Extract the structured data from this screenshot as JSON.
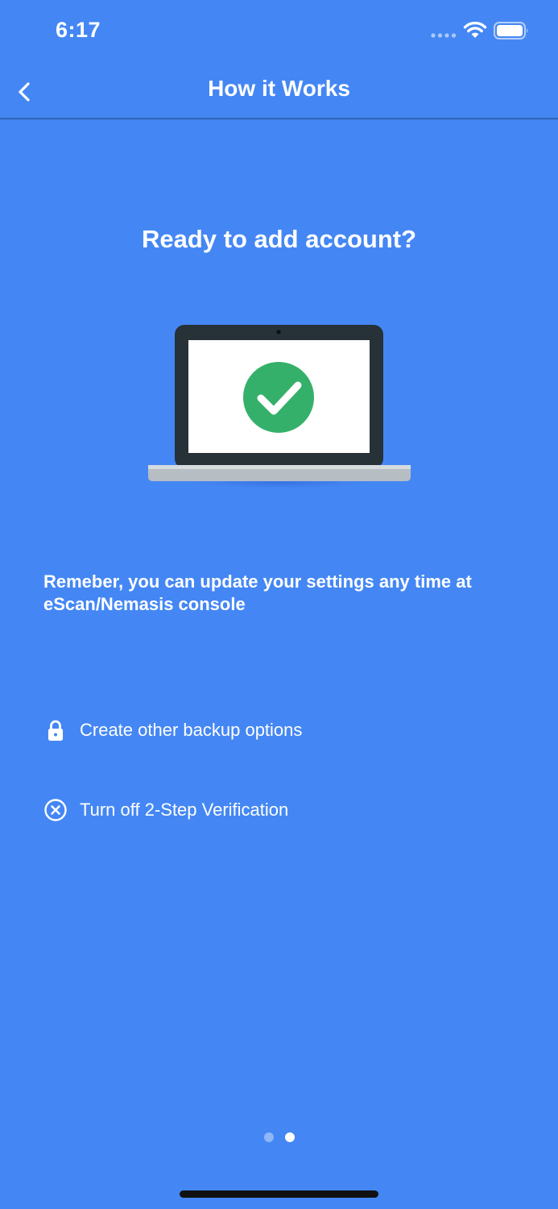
{
  "status_bar": {
    "time": "6:17"
  },
  "nav": {
    "title": "How it Works",
    "back_icon": "chevron-left-icon"
  },
  "headline": "Ready to add account?",
  "illustration": {
    "icon": "laptop-check-icon",
    "check_color": "#34b06a"
  },
  "description": "Remeber, you can update your settings any time at eScan/Nemasis console",
  "options": [
    {
      "icon": "lock-icon",
      "label": "Create other backup options"
    },
    {
      "icon": "close-circle-icon",
      "label": "Turn off 2-Step Verification"
    }
  ],
  "pagination": {
    "total": 2,
    "current": 2
  },
  "colors": {
    "background": "#4487f4",
    "text": "#ffffff",
    "accent_check": "#34b06a"
  }
}
